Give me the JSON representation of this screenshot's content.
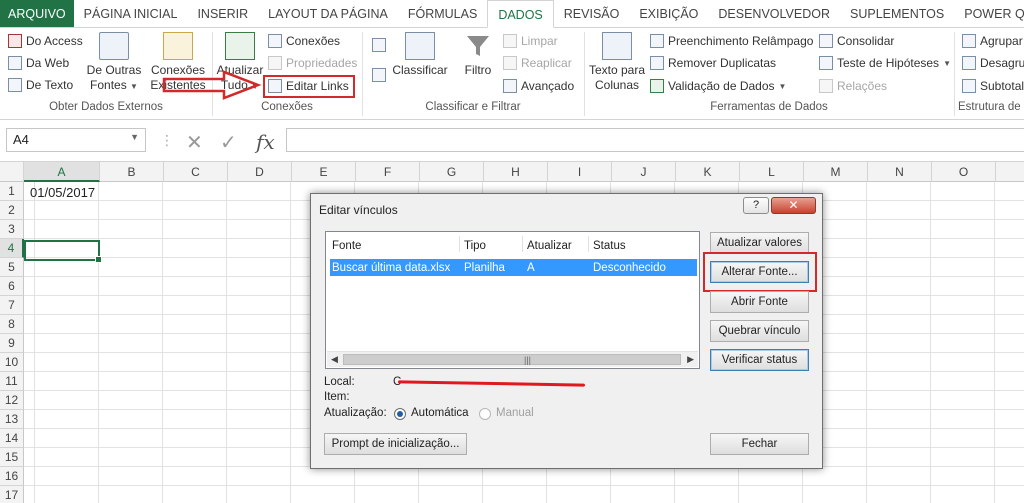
{
  "tabs": [
    "ARQUIVO",
    "PÁGINA INICIAL",
    "INSERIR",
    "LAYOUT DA PÁGINA",
    "FÓRMULAS",
    "DADOS",
    "REVISÃO",
    "EXIBIÇÃO",
    "DESENVOLVEDOR",
    "SUPLEMENTOS",
    "POWER QUERY"
  ],
  "active_tab": "DADOS",
  "ribbon": {
    "groups": {
      "external": "Obter Dados Externos",
      "connections": "Conexões",
      "sort_filter": "Classificar e Filtrar",
      "data_tools": "Ferramentas de Dados",
      "outline": "Estrutura de"
    },
    "external": {
      "access": "Do Access",
      "web": "Da Web",
      "text": "De Texto",
      "other_1": "De Outras",
      "other_2": "Fontes",
      "existing_1": "Conexões",
      "existing_2": "Existentes"
    },
    "connections": {
      "refresh_1": "Atualizar",
      "refresh_2": "Tudo",
      "conexoes": "Conexões",
      "propriedades": "Propriedades",
      "editar_links": "Editar Links"
    },
    "sort": {
      "classificar": "Classificar",
      "filtro": "Filtro",
      "limpar": "Limpar",
      "reaplicar": "Reaplicar",
      "avancado": "Avançado"
    },
    "tools": {
      "texto_1": "Texto para",
      "texto_2": "Colunas",
      "flash_fill": "Preenchimento Relâmpago",
      "remove_dup": "Remover Duplicatas",
      "validacao": "Validação de Dados",
      "consolidar": "Consolidar",
      "teste": "Teste de Hipóteses",
      "relacoes": "Relações"
    },
    "outline": {
      "agrupar": "Agrupar",
      "desagrupar": "Desagru",
      "subtotal": "Subtotal"
    }
  },
  "formula_bar": {
    "name_box": "A4",
    "fx": "fx",
    "value": ""
  },
  "grid": {
    "columns": [
      "A",
      "B",
      "C",
      "D",
      "E",
      "F",
      "G",
      "H",
      "I",
      "J",
      "K",
      "L",
      "M",
      "N",
      "O",
      "P"
    ],
    "rows": [
      "1",
      "2",
      "3",
      "4",
      "5",
      "6",
      "7",
      "8",
      "9",
      "10",
      "11",
      "12",
      "13",
      "14",
      "15",
      "16",
      "17"
    ],
    "selected_cell": "A4",
    "cell_A1": "01/05/2017"
  },
  "dialog": {
    "title": "Editar vínculos",
    "help": "?",
    "close": "✕",
    "columns": [
      "Fonte",
      "Tipo",
      "Atualizar",
      "Status"
    ],
    "rows": [
      {
        "fonte": "Buscar última data.xlsx",
        "tipo": "Planilha",
        "atualizar": "A",
        "status": "Desconhecido"
      }
    ],
    "buttons": {
      "atualizar_valores": "Atualizar valores",
      "alterar_fonte": "Alterar Fonte...",
      "abrir_fonte": "Abrir Fonte",
      "quebrar_vinculo": "Quebrar vínculo",
      "verificar_status": "Verificar status",
      "prompt": "Prompt de inicialização...",
      "fechar": "Fechar"
    },
    "labels": {
      "local": "Local:",
      "local_value": "C",
      "item": "Item:",
      "atualizacao": "Atualização:"
    },
    "update_mode": {
      "automatica": "Automática",
      "manual": "Manual",
      "selected": "Automática"
    }
  },
  "colors": {
    "excel_green": "#217346",
    "selection_blue": "#3399ff",
    "annotation_red": "#d22a2a"
  }
}
